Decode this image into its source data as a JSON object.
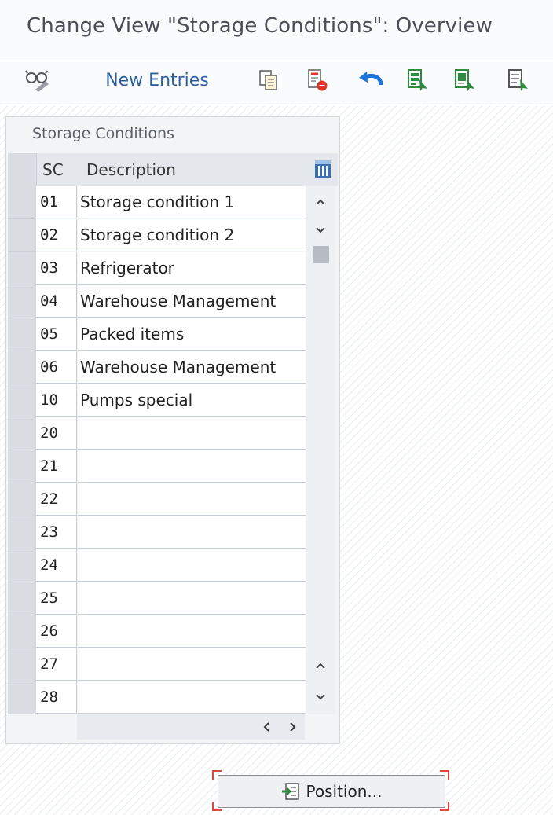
{
  "window": {
    "title": "Change View \"Storage Conditions\": Overview"
  },
  "toolbar": {
    "display_change_icon": "glasses-pencil-icon",
    "new_entries_label": "New Entries",
    "icons": [
      "copy-as-icon",
      "delete-icon",
      "undo-change-icon",
      "select-all-icon",
      "select-block-icon",
      "deselect-all-icon"
    ]
  },
  "panel": {
    "title": "Storage Conditions",
    "columns": {
      "sc": "SC",
      "description": "Description"
    },
    "rows": [
      {
        "sc": "01",
        "description": "Storage condition 1"
      },
      {
        "sc": "02",
        "description": "Storage condition 2"
      },
      {
        "sc": "03",
        "description": "Refrigerator"
      },
      {
        "sc": "04",
        "description": "Warehouse Management"
      },
      {
        "sc": "05",
        "description": "Packed items"
      },
      {
        "sc": "06",
        "description": "Warehouse Management"
      },
      {
        "sc": "10",
        "description": "Pumps special"
      },
      {
        "sc": "20",
        "description": ""
      },
      {
        "sc": "21",
        "description": ""
      },
      {
        "sc": "22",
        "description": ""
      },
      {
        "sc": "23",
        "description": ""
      },
      {
        "sc": "24",
        "description": ""
      },
      {
        "sc": "25",
        "description": ""
      },
      {
        "sc": "26",
        "description": ""
      },
      {
        "sc": "27",
        "description": ""
      },
      {
        "sc": "28",
        "description": ""
      }
    ]
  },
  "position_button": {
    "label": "Position..."
  },
  "colors": {
    "accent_blue": "#2f5f9e",
    "green_icon": "#2e8b3d",
    "red_icon": "#d9362b",
    "focus_red": "#e0473b"
  }
}
